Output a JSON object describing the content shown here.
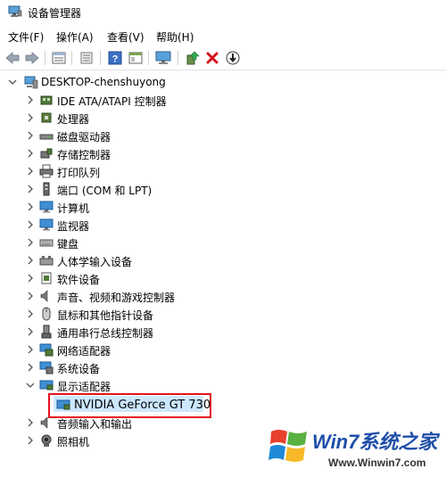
{
  "window": {
    "title": "设备管理器",
    "icon": "device-manager-icon"
  },
  "menu": [
    {
      "label": "文件(F)"
    },
    {
      "label": "操作(A)"
    },
    {
      "label": "查看(V)"
    },
    {
      "label": "帮助(H)"
    }
  ],
  "toolbar": {
    "buttons": [
      "back-icon",
      "forward-icon",
      "properties-icon",
      "show-icon",
      "help-icon",
      "view-icon",
      "monitor-icon",
      "update-driver-icon",
      "uninstall-icon",
      "download-icon"
    ]
  },
  "tree": {
    "root": "DESKTOP-chenshuyong",
    "items": [
      {
        "label": "IDE ATA/ATAPI 控制器",
        "icon": "ide-controller-icon"
      },
      {
        "label": "处理器",
        "icon": "processor-icon"
      },
      {
        "label": "磁盘驱动器",
        "icon": "disk-drive-icon"
      },
      {
        "label": "存储控制器",
        "icon": "storage-controller-icon"
      },
      {
        "label": "打印队列",
        "icon": "print-queue-icon"
      },
      {
        "label": "端口 (COM 和 LPT)",
        "icon": "port-icon"
      },
      {
        "label": "计算机",
        "icon": "computer-icon"
      },
      {
        "label": "监视器",
        "icon": "monitor-icon"
      },
      {
        "label": "键盘",
        "icon": "keyboard-icon"
      },
      {
        "label": "人体学输入设备",
        "icon": "hid-icon"
      },
      {
        "label": "软件设备",
        "icon": "software-device-icon"
      },
      {
        "label": "声音、视频和游戏控制器",
        "icon": "sound-icon"
      },
      {
        "label": "鼠标和其他指针设备",
        "icon": "mouse-icon"
      },
      {
        "label": "通用串行总线控制器",
        "icon": "usb-icon"
      },
      {
        "label": "网络适配器",
        "icon": "network-adapter-icon"
      },
      {
        "label": "系统设备",
        "icon": "system-device-icon"
      },
      {
        "label": "显示适配器",
        "icon": "display-adapter-icon",
        "expanded": true
      },
      {
        "label": "NVIDIA GeForce GT 730",
        "icon": "gpu-icon",
        "child": true,
        "selected": true
      },
      {
        "label": "音频输入和输出",
        "icon": "audio-io-icon"
      },
      {
        "label": "照相机",
        "icon": "camera-icon"
      }
    ]
  },
  "watermark": {
    "brand": "Win7系统之家",
    "url": "Www.Winwin7.com"
  },
  "colors": {
    "selection": "#cce8ff",
    "highlight_border": "#e0141e"
  }
}
